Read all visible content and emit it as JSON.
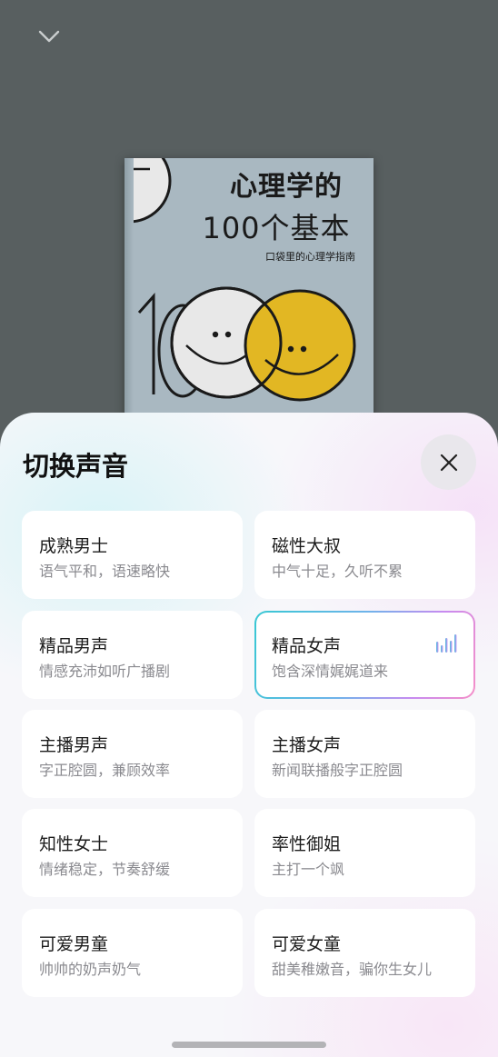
{
  "book": {
    "title_line1": "心理学的",
    "title_line2": "100个基本",
    "subtitle": "口袋里的心理学指南"
  },
  "sheet": {
    "title": "切换声音"
  },
  "voices": [
    {
      "name": "成熟男士",
      "desc": "语气平和，语速略快",
      "selected": false
    },
    {
      "name": "磁性大叔",
      "desc": "中气十足，久听不累",
      "selected": false
    },
    {
      "name": "精品男声",
      "desc": "情感充沛如听广播剧",
      "selected": false
    },
    {
      "name": "精品女声",
      "desc": "饱含深情娓娓道来",
      "selected": true
    },
    {
      "name": "主播男声",
      "desc": "字正腔圆，兼顾效率",
      "selected": false
    },
    {
      "name": "主播女声",
      "desc": "新闻联播般字正腔圆",
      "selected": false
    },
    {
      "name": "知性女士",
      "desc": "情绪稳定，节奏舒缓",
      "selected": false
    },
    {
      "name": "率性御姐",
      "desc": "主打一个飒",
      "selected": false
    },
    {
      "name": "可爱男童",
      "desc": "帅帅的奶声奶气",
      "selected": false
    },
    {
      "name": "可爱女童",
      "desc": "甜美稚嫩音，骗你生女儿",
      "selected": false
    }
  ],
  "colors": {
    "backdrop": "#585f60",
    "selected_gradient": [
      "#37c8d3",
      "#6fb3ea",
      "#c78bf0",
      "#f58fc8"
    ],
    "smiley_yellow": "#e2b723",
    "smiley_white": "#e8e8e8"
  },
  "icons": {
    "collapse": "chevron-down-icon",
    "close": "close-icon",
    "playing": "equalizer-icon"
  }
}
